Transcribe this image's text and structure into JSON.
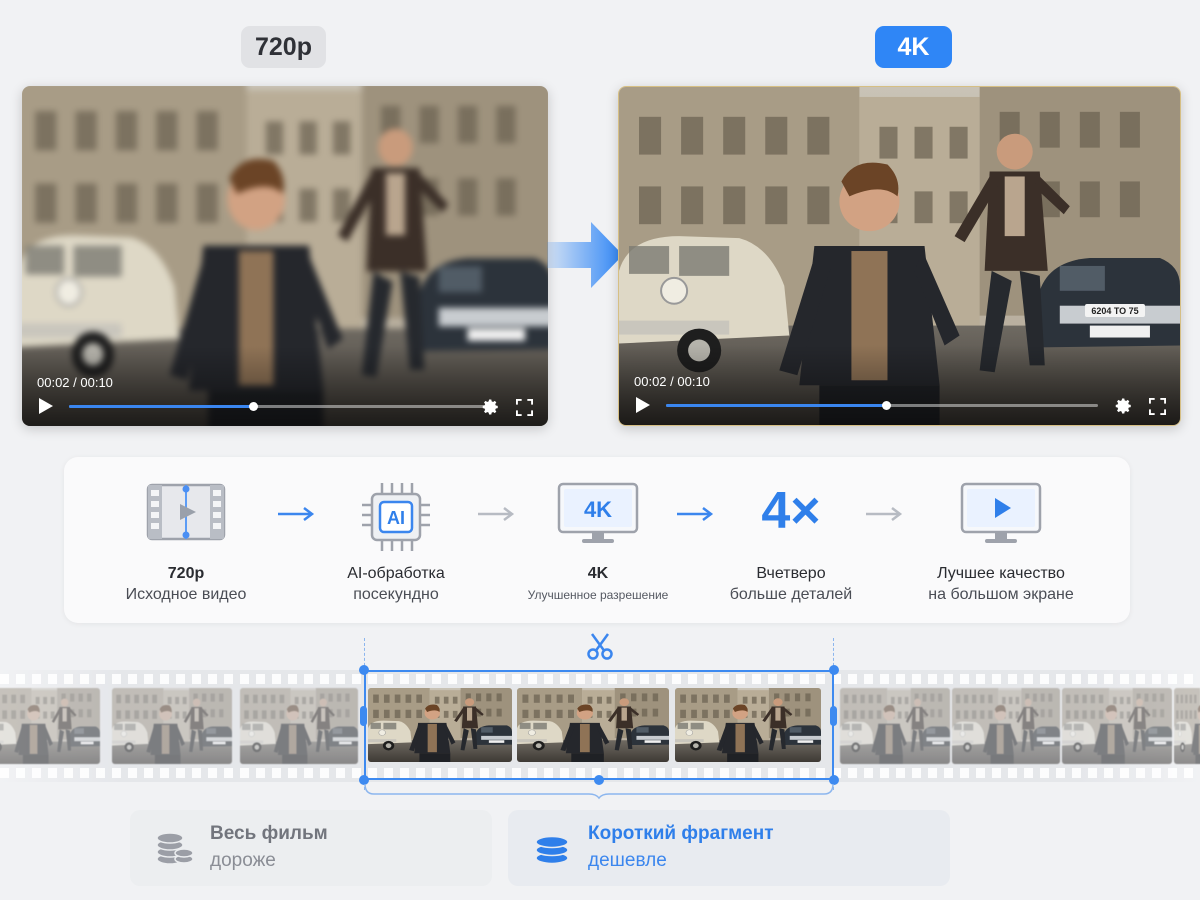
{
  "comparison": {
    "left_badge": "720p",
    "right_badge": "4K",
    "left_player": {
      "timecode": "00:02 / 00:10",
      "progress": 0.44
    },
    "right_player": {
      "timecode": "00:02 / 00:10",
      "progress": 0.51,
      "plate": "6204 TO 75"
    }
  },
  "pipeline": {
    "steps": [
      {
        "icon": "film-icon",
        "title": "720p",
        "subtitle": "Исходное видео"
      },
      {
        "icon": "ai-chip-icon",
        "icon_text": "AI",
        "title": "AI-обработка",
        "subtitle": "посекундно"
      },
      {
        "icon": "monitor-4k-icon",
        "icon_text": "4K",
        "title": "4K",
        "subtitle": "Улучшенное разрешение"
      },
      {
        "icon": "times-four-icon",
        "icon_text": "4×",
        "title": "Вчетверо",
        "subtitle": "больше деталей"
      },
      {
        "icon": "monitor-play-icon",
        "title": "Лучшее качество",
        "subtitle": "на большом экране"
      }
    ]
  },
  "cost": {
    "full": {
      "title": "Весь фильм",
      "subtitle": "дороже"
    },
    "short": {
      "title": "Короткий фрагмент",
      "subtitle": "дешевле"
    }
  },
  "colors": {
    "accent": "#2f86f6",
    "muted": "#8a8d95"
  }
}
